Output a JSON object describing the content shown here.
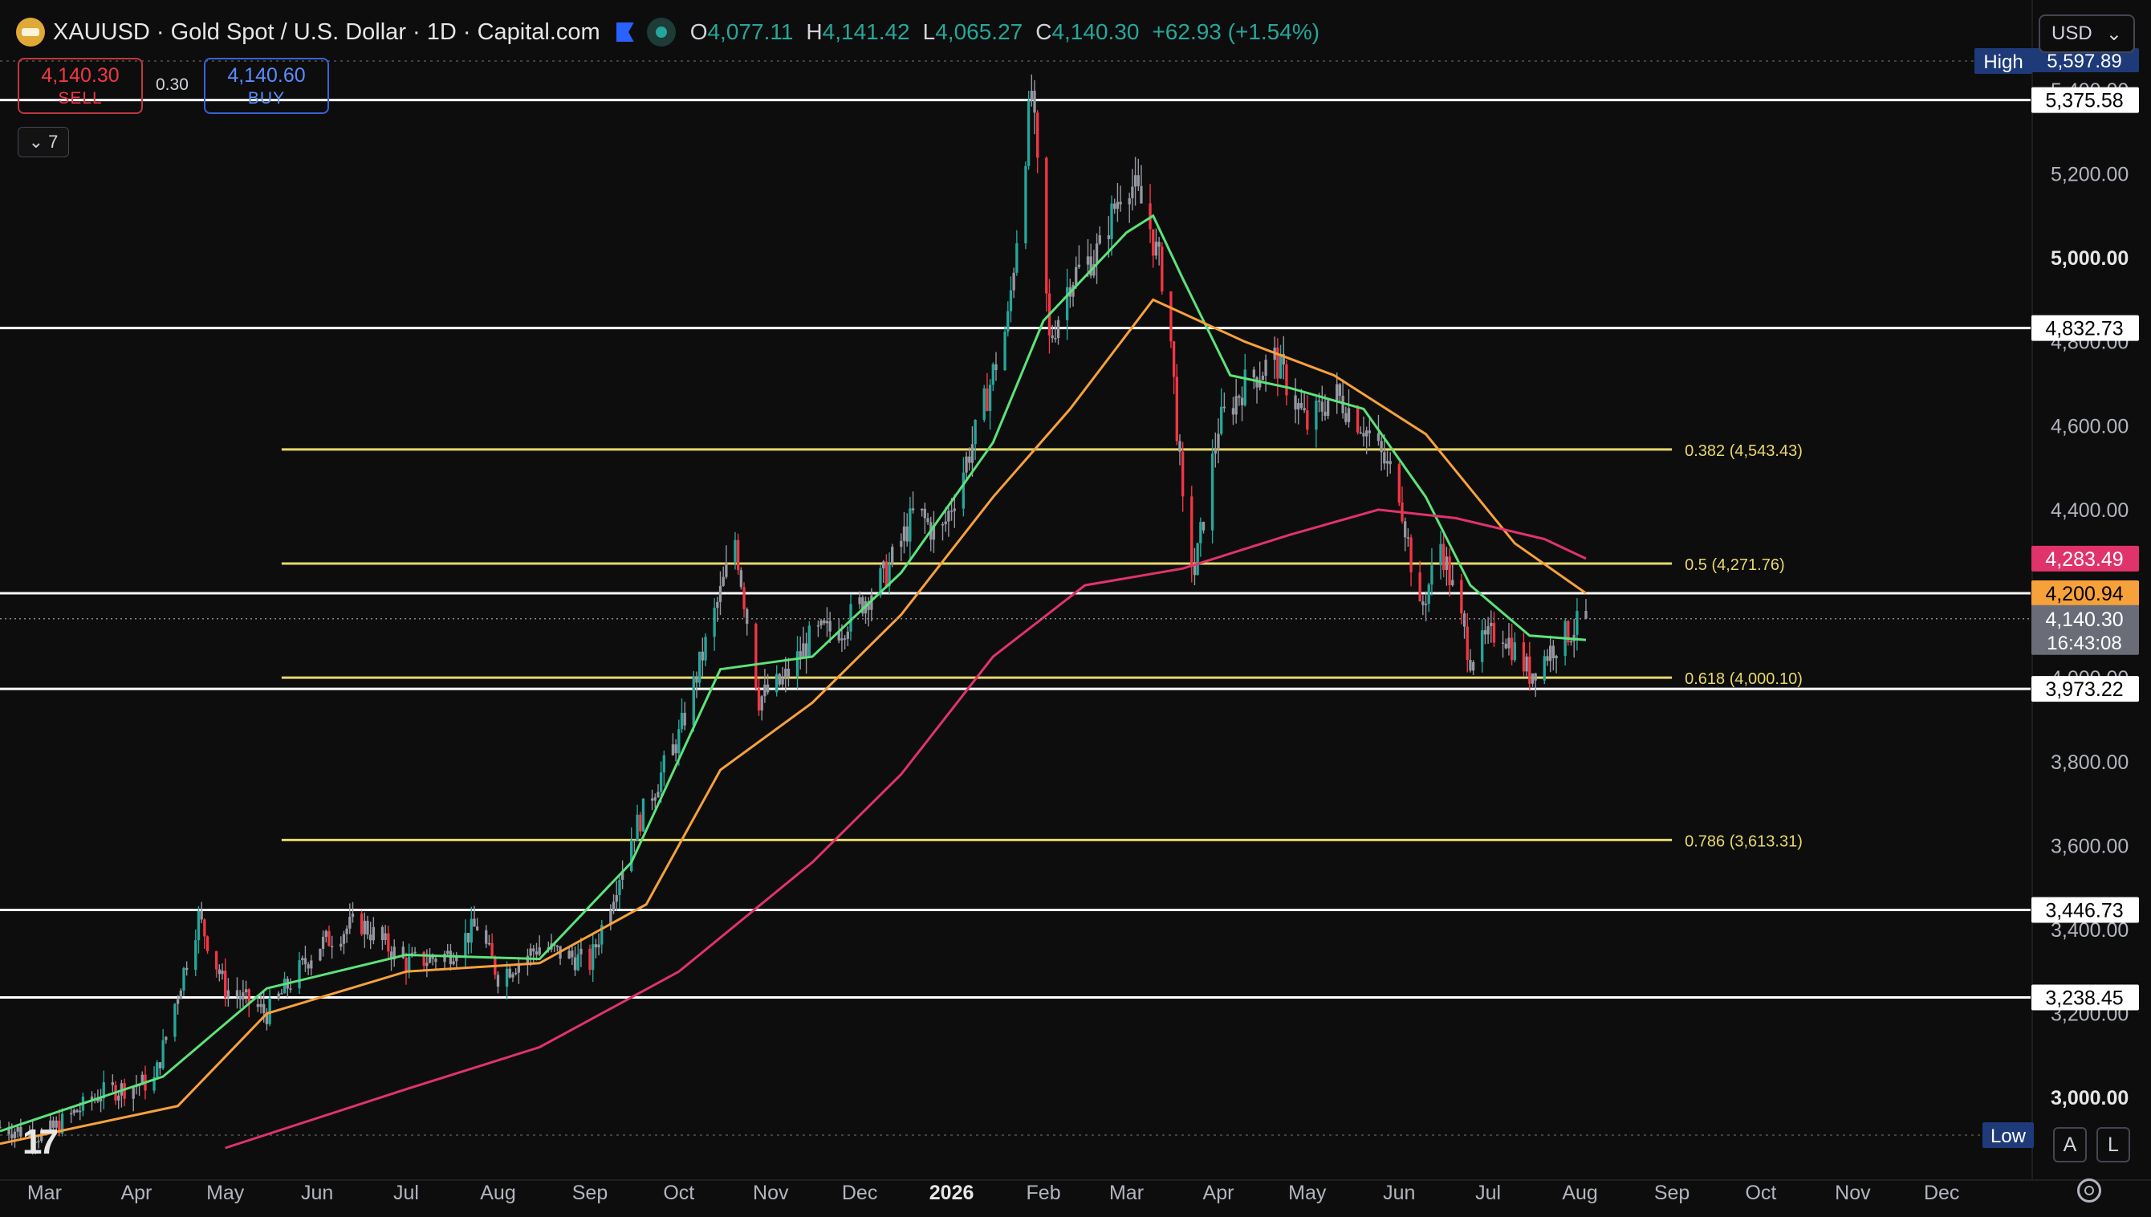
{
  "header": {
    "title": "XAUUSD · Gold Spot / U.S. Dollar · 1D · Capital.com",
    "ohlc": [
      {
        "k": "O",
        "v": "4,077.11"
      },
      {
        "k": "H",
        "v": "4,141.42"
      },
      {
        "k": "L",
        "v": "4,065.27"
      },
      {
        "k": "C",
        "v": "4,140.30"
      }
    ],
    "change": "+62.93 (+1.54%)"
  },
  "trade": {
    "sell_price": "4,140.30",
    "sell_label": "SELL",
    "spread": "0.30",
    "buy_price": "4,140.60",
    "buy_label": "BUY"
  },
  "indicators_toggle": "7",
  "currency": "USD",
  "bottom_buttons": {
    "auto": "A",
    "log": "L"
  },
  "colors": {
    "background": "#0d0d0d",
    "up_candle": "#26a69a",
    "down_candle": "#f23645",
    "neutral_candle": "#9598a1",
    "ema_fast": "#5be37a",
    "ema_mid": "#f7a13a",
    "ema_slow": "#e0336b",
    "fib": "#e8d86b",
    "horizontal": "#ffffff"
  },
  "chart_data": {
    "type": "candlestick",
    "symbol": "XAUUSD",
    "timeframe": "1D",
    "y_axis": {
      "range": [
        2880,
        5480
      ],
      "ticks": [
        {
          "value": 3000,
          "label": "3,000.00",
          "bold": true
        },
        {
          "value": 3200,
          "label": "3,200.00"
        },
        {
          "value": 3400,
          "label": "3,400.00"
        },
        {
          "value": 3600,
          "label": "3,600.00"
        },
        {
          "value": 3800,
          "label": "3,800.00"
        },
        {
          "value": 4000,
          "label": "4,000.00"
        },
        {
          "value": 4200,
          "label": "4,200.00"
        },
        {
          "value": 4400,
          "label": "4,400.00"
        },
        {
          "value": 4600,
          "label": "4,600.00"
        },
        {
          "value": 4800,
          "label": "4,800.00"
        },
        {
          "value": 5000,
          "label": "5,000.00",
          "bold": true
        },
        {
          "value": 5200,
          "label": "5,200.00"
        },
        {
          "value": 5400,
          "label": "5,400.00"
        }
      ]
    },
    "x_axis": {
      "range": [
        "2025-02-14",
        "2026-12-31"
      ],
      "ticks": [
        {
          "date": "2025-03-01",
          "label": "Mar"
        },
        {
          "date": "2025-04-01",
          "label": "Apr"
        },
        {
          "date": "2025-05-01",
          "label": "May"
        },
        {
          "date": "2025-06-01",
          "label": "Jun"
        },
        {
          "date": "2025-07-01",
          "label": "Jul"
        },
        {
          "date": "2025-08-01",
          "label": "Aug"
        },
        {
          "date": "2025-09-01",
          "label": "Sep"
        },
        {
          "date": "2025-10-01",
          "label": "Oct"
        },
        {
          "date": "2025-11-01",
          "label": "Nov"
        },
        {
          "date": "2025-12-01",
          "label": "Dec"
        },
        {
          "date": "2026-01-01",
          "label": "2026",
          "bold": true
        },
        {
          "date": "2026-02-01",
          "label": "Feb"
        },
        {
          "date": "2026-03-01",
          "label": "Mar"
        },
        {
          "date": "2026-04-01",
          "label": "Apr"
        },
        {
          "date": "2026-05-01",
          "label": "May"
        },
        {
          "date": "2026-06-01",
          "label": "Jun"
        },
        {
          "date": "2026-07-01",
          "label": "Jul"
        },
        {
          "date": "2026-08-01",
          "label": "Aug"
        },
        {
          "date": "2026-09-01",
          "label": "Sep"
        },
        {
          "date": "2026-10-01",
          "label": "Oct"
        },
        {
          "date": "2026-11-01",
          "label": "Nov"
        },
        {
          "date": "2026-12-01",
          "label": "Dec"
        }
      ]
    },
    "price_path": [
      [
        "2025-02-14",
        2930
      ],
      [
        "2025-03-01",
        2910
      ],
      [
        "2025-03-20",
        3010
      ],
      [
        "2025-04-07",
        3040
      ],
      [
        "2025-04-15",
        3250
      ],
      [
        "2025-04-22",
        3430
      ],
      [
        "2025-05-01",
        3260
      ],
      [
        "2025-05-15",
        3200
      ],
      [
        "2025-06-01",
        3360
      ],
      [
        "2025-06-15",
        3420
      ],
      [
        "2025-07-01",
        3320
      ],
      [
        "2025-07-15",
        3340
      ],
      [
        "2025-07-25",
        3410
      ],
      [
        "2025-08-01",
        3290
      ],
      [
        "2025-08-15",
        3360
      ],
      [
        "2025-09-01",
        3320
      ],
      [
        "2025-09-15",
        3620
      ],
      [
        "2025-10-01",
        3860
      ],
      [
        "2025-10-15",
        4200
      ],
      [
        "2025-10-20",
        4330
      ],
      [
        "2025-10-28",
        3950
      ],
      [
        "2025-11-05",
        3990
      ],
      [
        "2025-11-15",
        4100
      ],
      [
        "2025-11-25",
        4120
      ],
      [
        "2025-12-10",
        4250
      ],
      [
        "2025-12-20",
        4400
      ],
      [
        "2025-12-28",
        4330
      ],
      [
        "2026-01-10",
        4600
      ],
      [
        "2026-01-20",
        4850
      ],
      [
        "2026-01-28",
        5400
      ],
      [
        "2026-02-03",
        4800
      ],
      [
        "2026-02-10",
        4950
      ],
      [
        "2026-02-20",
        5020
      ],
      [
        "2026-03-01",
        5200
      ],
      [
        "2026-03-08",
        5100
      ],
      [
        "2026-03-15",
        4900
      ],
      [
        "2026-03-20",
        4400
      ],
      [
        "2026-03-24",
        4250
      ],
      [
        "2026-04-01",
        4600
      ],
      [
        "2026-04-10",
        4700
      ],
      [
        "2026-04-20",
        4760
      ],
      [
        "2026-05-01",
        4600
      ],
      [
        "2026-05-10",
        4680
      ],
      [
        "2026-05-20",
        4600
      ],
      [
        "2026-06-01",
        4450
      ],
      [
        "2026-06-08",
        4150
      ],
      [
        "2026-06-15",
        4320
      ],
      [
        "2026-06-25",
        4050
      ],
      [
        "2026-07-05",
        4120
      ],
      [
        "2026-07-15",
        4010
      ],
      [
        "2026-07-25",
        4090
      ],
      [
        "2026-08-03",
        4140.3
      ]
    ],
    "moving_averages": [
      {
        "color": "#5be37a",
        "points": [
          [
            "2025-02-14",
            2920
          ],
          [
            "2025-04-10",
            3050
          ],
          [
            "2025-05-15",
            3260
          ],
          [
            "2025-07-01",
            3340
          ],
          [
            "2025-08-15",
            3330
          ],
          [
            "2025-09-15",
            3560
          ],
          [
            "2025-10-15",
            4020
          ],
          [
            "2025-11-15",
            4050
          ],
          [
            "2025-12-15",
            4250
          ],
          [
            "2026-01-15",
            4560
          ],
          [
            "2026-02-01",
            4850
          ],
          [
            "2026-03-01",
            5060
          ],
          [
            "2026-03-10",
            5100
          ],
          [
            "2026-03-20",
            4950
          ],
          [
            "2026-04-05",
            4720
          ],
          [
            "2026-04-25",
            4690
          ],
          [
            "2026-05-20",
            4640
          ],
          [
            "2026-06-10",
            4430
          ],
          [
            "2026-06-25",
            4220
          ],
          [
            "2026-07-15",
            4100
          ],
          [
            "2026-08-03",
            4090
          ]
        ]
      },
      {
        "color": "#f7a13a",
        "points": [
          [
            "2025-02-14",
            2890
          ],
          [
            "2025-04-15",
            2980
          ],
          [
            "2025-05-15",
            3200
          ],
          [
            "2025-07-01",
            3300
          ],
          [
            "2025-08-15",
            3320
          ],
          [
            "2025-09-20",
            3460
          ],
          [
            "2025-10-15",
            3780
          ],
          [
            "2025-11-15",
            3940
          ],
          [
            "2025-12-15",
            4150
          ],
          [
            "2026-01-15",
            4430
          ],
          [
            "2026-02-10",
            4640
          ],
          [
            "2026-03-10",
            4900
          ],
          [
            "2026-04-10",
            4800
          ],
          [
            "2026-05-10",
            4720
          ],
          [
            "2026-06-10",
            4580
          ],
          [
            "2026-07-10",
            4320
          ],
          [
            "2026-08-03",
            4200.94
          ]
        ]
      },
      {
        "color": "#e0336b",
        "points": [
          [
            "2025-05-01",
            2880
          ],
          [
            "2025-07-01",
            3020
          ],
          [
            "2025-08-15",
            3120
          ],
          [
            "2025-10-01",
            3300
          ],
          [
            "2025-11-15",
            3560
          ],
          [
            "2025-12-15",
            3770
          ],
          [
            "2026-01-15",
            4050
          ],
          [
            "2026-02-15",
            4220
          ],
          [
            "2026-03-20",
            4260
          ],
          [
            "2026-04-25",
            4340
          ],
          [
            "2026-05-25",
            4400
          ],
          [
            "2026-06-20",
            4380
          ],
          [
            "2026-07-20",
            4330
          ],
          [
            "2026-08-03",
            4283.49
          ]
        ]
      }
    ],
    "fibonacci": {
      "start": "2025-05-20",
      "end": "2026-09-01",
      "levels": [
        {
          "ratio": 0.382,
          "value": 4543.43,
          "label": "0.382 (4,543.43)"
        },
        {
          "ratio": 0.5,
          "value": 4271.76,
          "label": "0.5 (4,271.76)"
        },
        {
          "ratio": 0.618,
          "value": 4000.1,
          "label": "0.618 (4,000.10)"
        },
        {
          "ratio": 0.786,
          "value": 3613.31,
          "label": "0.786 (3,613.31)"
        }
      ]
    },
    "horizontal_lines": [
      {
        "value": 5375.58,
        "label": "5,375.58"
      },
      {
        "value": 4832.73,
        "label": "4,832.73"
      },
      {
        "value": 4200.94,
        "label": ""
      },
      {
        "value": 3973.22,
        "label": "3,973.22"
      },
      {
        "value": 3446.73,
        "label": "3,446.73"
      },
      {
        "value": 3238.45,
        "label": "3,238.45"
      }
    ],
    "price_tags": [
      {
        "value": 4283.49,
        "label": "4,283.49",
        "bg": "#e0336b",
        "fg": "#ffffff"
      },
      {
        "value": 4200.94,
        "label": "4,200.94",
        "bg": "#f7a13a",
        "fg": "#000000"
      }
    ],
    "last_price": {
      "value": 4140.3,
      "label": "4,140.30",
      "countdown": "16:43:08"
    },
    "high_marker": {
      "label": "High",
      "value": 5597.89,
      "value_label": "5,597.89"
    },
    "low_marker": {
      "label": "Low"
    }
  }
}
